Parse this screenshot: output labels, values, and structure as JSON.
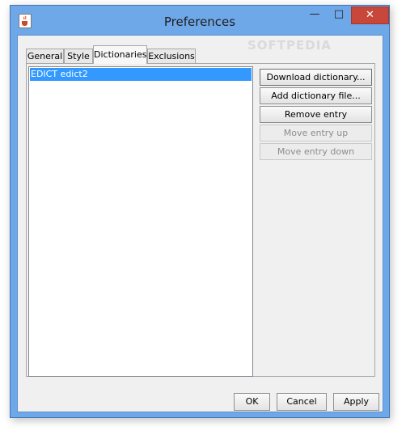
{
  "window": {
    "title": "Preferences"
  },
  "title_controls": {
    "minimize": "—",
    "maximize": "□",
    "close": "✕"
  },
  "tabs": [
    {
      "label": "General"
    },
    {
      "label": "Style"
    },
    {
      "label": "Dictionaries"
    },
    {
      "label": "Exclusions"
    }
  ],
  "selected_tab": "Dictionaries",
  "dictionaries": {
    "entries": [
      "EDICT edict2"
    ],
    "buttons": {
      "download": "Download dictionary...",
      "add_file": "Add dictionary file...",
      "remove": "Remove entry",
      "move_up": "Move entry up",
      "move_down": "Move entry down"
    }
  },
  "footer": {
    "ok": "OK",
    "cancel": "Cancel",
    "apply": "Apply"
  },
  "watermark": "SOFTPEDIA",
  "colors": {
    "selection": "#3399ff",
    "titlebar": "#6fa8e8",
    "close": "#c7473b"
  },
  "icons": {
    "app": "java-cup-icon"
  }
}
